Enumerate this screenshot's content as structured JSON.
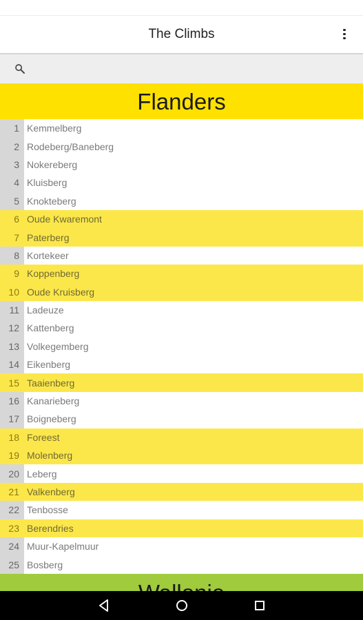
{
  "app": {
    "title": "The Climbs"
  },
  "search": {
    "placeholder": "",
    "value": ""
  },
  "sections": [
    {
      "name": "Flanders",
      "color": "#ffe100"
    },
    {
      "name": "Wallonie",
      "color": "#9fcb3d"
    }
  ],
  "climbs": [
    {
      "num": "1",
      "name": "Kemmelberg",
      "highlight": false
    },
    {
      "num": "2",
      "name": "Rodeberg/Baneberg",
      "highlight": false
    },
    {
      "num": "3",
      "name": "Nokereberg",
      "highlight": false
    },
    {
      "num": "4",
      "name": "Kluisberg",
      "highlight": false
    },
    {
      "num": "5",
      "name": "Knokteberg",
      "highlight": false
    },
    {
      "num": "6",
      "name": "Oude Kwaremont",
      "highlight": true
    },
    {
      "num": "7",
      "name": "Paterberg",
      "highlight": true
    },
    {
      "num": "8",
      "name": "Kortekeer",
      "highlight": false
    },
    {
      "num": "9",
      "name": "Koppenberg",
      "highlight": true
    },
    {
      "num": "10",
      "name": "Oude Kruisberg",
      "highlight": true
    },
    {
      "num": "11",
      "name": "Ladeuze",
      "highlight": false
    },
    {
      "num": "12",
      "name": "Kattenberg",
      "highlight": false
    },
    {
      "num": "13",
      "name": "Volkegemberg",
      "highlight": false
    },
    {
      "num": "14",
      "name": "Eikenberg",
      "highlight": false
    },
    {
      "num": "15",
      "name": "Taaienberg",
      "highlight": true
    },
    {
      "num": "16",
      "name": "Kanarieberg",
      "highlight": false
    },
    {
      "num": "17",
      "name": "Boigneberg",
      "highlight": false
    },
    {
      "num": "18",
      "name": "Foreest",
      "highlight": true
    },
    {
      "num": "19",
      "name": "Molenberg",
      "highlight": true
    },
    {
      "num": "20",
      "name": "Leberg",
      "highlight": false
    },
    {
      "num": "21",
      "name": "Valkenberg",
      "highlight": true
    },
    {
      "num": "22",
      "name": "Tenbosse",
      "highlight": false
    },
    {
      "num": "23",
      "name": "Berendries",
      "highlight": true
    },
    {
      "num": "24",
      "name": "Muur-Kapelmuur",
      "highlight": false
    },
    {
      "num": "25",
      "name": "Bosberg",
      "highlight": false
    }
  ],
  "icons": {
    "search": "search-icon",
    "overflow": "overflow-menu-icon",
    "back": "nav-back-icon",
    "home": "nav-home-icon",
    "recents": "nav-recents-icon"
  },
  "colors": {
    "highlight": "#fce74b",
    "number_bg": "#d7d7d7"
  }
}
